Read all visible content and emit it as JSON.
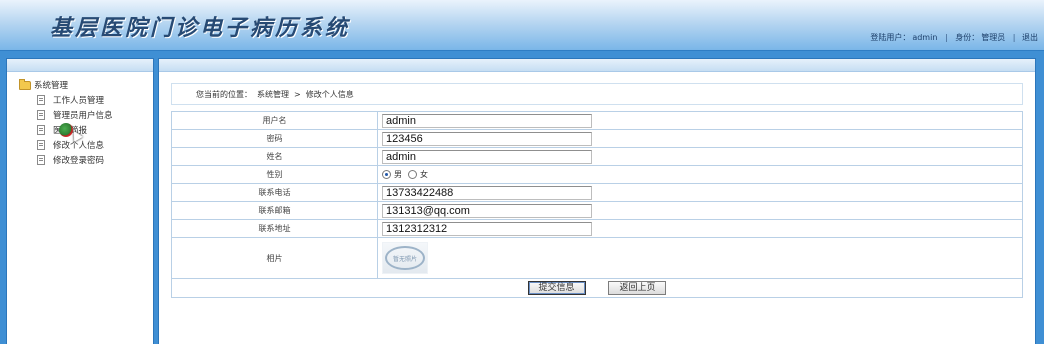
{
  "app": {
    "title": "基层医院门诊电子病历系统"
  },
  "header": {
    "login_user_label": "登陆用户：",
    "login_user": "admin",
    "identity_label": "身份：",
    "identity": "管理员",
    "separator": "|",
    "logout": "退出"
  },
  "sidebar": {
    "root_label": "系统管理",
    "items": [
      {
        "label": "工作人员管理"
      },
      {
        "label": "管理员用户信息"
      },
      {
        "label": "医院简报"
      },
      {
        "label": "修改个人信息"
      },
      {
        "label": "修改登录密码"
      }
    ]
  },
  "breadcrumb": {
    "prefix": "您当前的位置：",
    "section": "系统管理",
    "arrow": ">",
    "page": "修改个人信息"
  },
  "form": {
    "username_label": "用户名",
    "username": "admin",
    "password_label": "密码",
    "password": "123456",
    "name_label": "姓名",
    "name": "admin",
    "gender_label": "性别",
    "gender_options": [
      "男",
      "女"
    ],
    "gender_selected": "男",
    "phone_label": "联系电话",
    "phone": "13733422488",
    "email_label": "联系邮箱",
    "email": "131313@qq.com",
    "address_label": "联系地址",
    "address": "1312312312",
    "photo_label": "相片",
    "photo_placeholder": "暂无照片",
    "submit_label": "提交信息",
    "back_label": "返回上页"
  },
  "colors": {
    "page_background": "#3f8fd4",
    "header_title": "#274a74",
    "border": "#b9d0e6"
  }
}
